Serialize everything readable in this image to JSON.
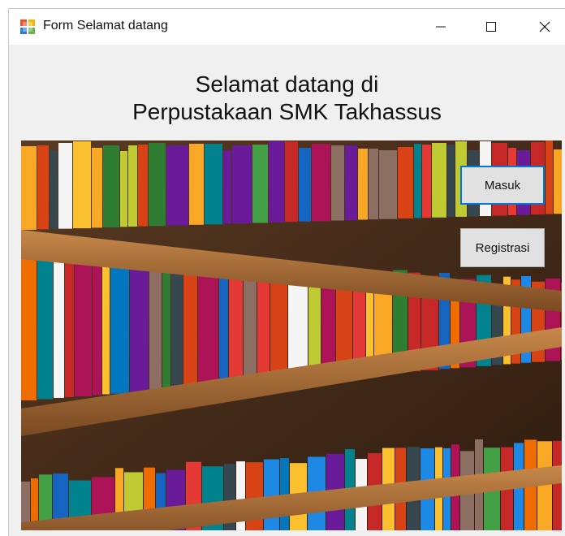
{
  "window": {
    "title": "Form Selamat datang",
    "controls": {
      "minimize_icon": "minimize-icon",
      "maximize_icon": "maximize-icon",
      "close_icon": "close-icon"
    }
  },
  "heading": {
    "line1": "Selamat datang di",
    "line2": "Perpustakaan SMK Takhassus"
  },
  "buttons": {
    "masuk": "Masuk",
    "registrasi": "Registrasi"
  },
  "image": {
    "subject": "bookshelf-photo"
  },
  "colors": {
    "focus_border": "#0078d7",
    "button_face": "#e1e1e1",
    "window_bg": "#f0f0f0"
  }
}
